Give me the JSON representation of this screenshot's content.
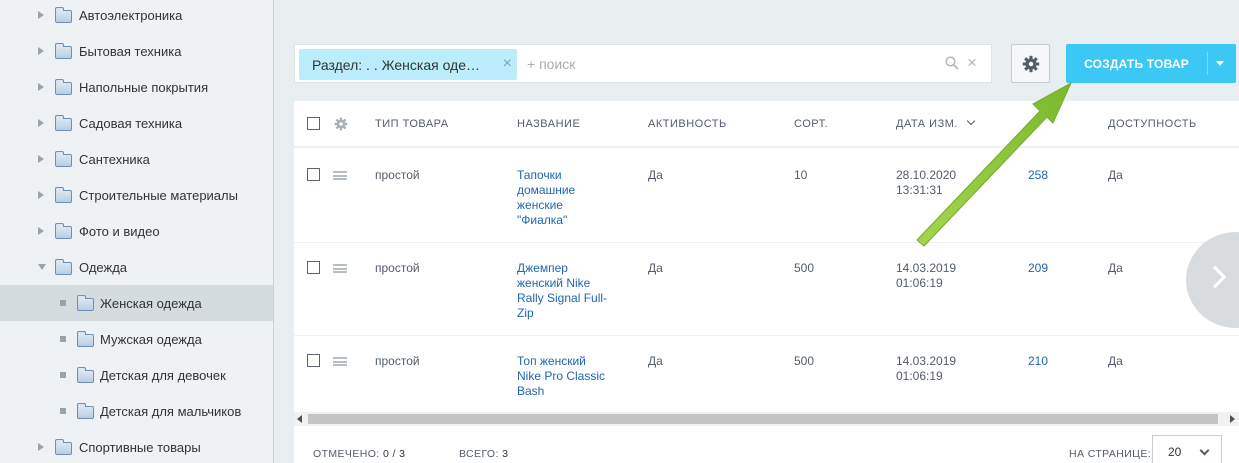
{
  "sidebar": {
    "items": [
      {
        "label": "Автоэлектроника"
      },
      {
        "label": "Бытовая техника"
      },
      {
        "label": "Напольные покрытия"
      },
      {
        "label": "Садовая техника"
      },
      {
        "label": "Сантехника"
      },
      {
        "label": "Строительные материалы"
      },
      {
        "label": "Фото и видео"
      },
      {
        "label": "Одежда"
      },
      {
        "label": "Женская одежда"
      },
      {
        "label": "Мужская одежда"
      },
      {
        "label": "Детская для девочек"
      },
      {
        "label": "Детская для мальчиков"
      },
      {
        "label": "Спортивные товары"
      }
    ],
    "selected": "Женская одежда"
  },
  "filter": {
    "chip_label": "Раздел: . . Женская оде…",
    "chip_close": "×",
    "placeholder": "+ поиск",
    "clear": "×"
  },
  "toolbar": {
    "create_label": "СОЗДАТЬ ТОВАР"
  },
  "grid": {
    "columns": [
      "ТИП ТОВАРА",
      "НАЗВАНИЕ",
      "АКТИВНОСТЬ",
      "СОРТ.",
      "ДАТА ИЗМ.",
      "ДОСТУПНОСТЬ"
    ],
    "rows": [
      {
        "type": "простой",
        "name": [
          "Тапочки",
          "домашние",
          "женские",
          "\"Фиалка\""
        ],
        "active": "Да",
        "sort": "10",
        "date": "28.10.2020",
        "time": "13:31:31",
        "id": "258",
        "available": "Да"
      },
      {
        "type": "простой",
        "name": [
          "Джемпер",
          "женский Nike",
          "Rally Signal Full-",
          "Zip"
        ],
        "active": "Да",
        "sort": "500",
        "date": "14.03.2019",
        "time": "01:06:19",
        "id": "209",
        "available": "Да"
      },
      {
        "type": "простой",
        "name": [
          "Топ женский",
          "Nike Pro Classic",
          "Bash"
        ],
        "active": "Да",
        "sort": "500",
        "date": "14.03.2019",
        "time": "01:06:19",
        "id": "210",
        "available": "Да"
      }
    ]
  },
  "footer": {
    "marked_label": "ОТМЕЧЕНО:",
    "marked_value": "0 / 3",
    "total_label": "ВСЕГО:",
    "total_value": "3",
    "per_page_label": "НА СТРАНИЦЕ:",
    "per_page_value": "20"
  },
  "colors": {
    "accent": "#3bc8f5",
    "chip": "#bcedfc",
    "link": "#2067b0",
    "annotation_arrow": "#8dc63f"
  }
}
